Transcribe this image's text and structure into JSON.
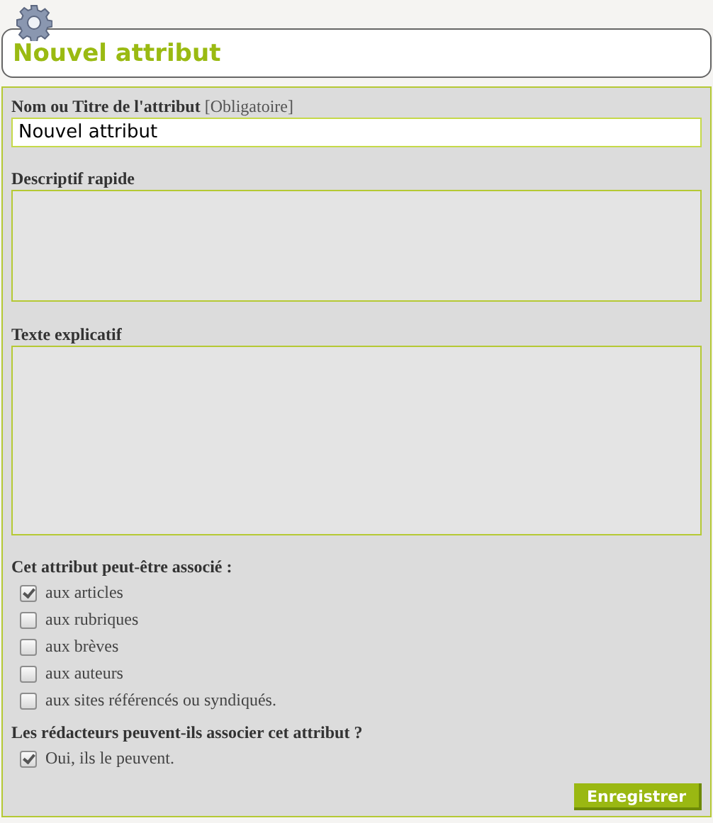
{
  "title": "Nouvel attribut",
  "name_field": {
    "label": "Nom ou Titre de l'attribut",
    "note": "[Obligatoire]",
    "value": "Nouvel attribut"
  },
  "description_field": {
    "label": "Descriptif rapide"
  },
  "explanation_field": {
    "label": "Texte explicatif"
  },
  "association": {
    "label": "Cet attribut peut-être associé :",
    "options": [
      {
        "label": "aux articles",
        "checked": true
      },
      {
        "label": "aux rubriques",
        "checked": false
      },
      {
        "label": "aux brèves",
        "checked": false
      },
      {
        "label": "aux auteurs",
        "checked": false
      },
      {
        "label": "aux sites référencés ou syndiqués.",
        "checked": false
      }
    ]
  },
  "editors": {
    "label": "Les rédacteurs peuvent-ils associer cet attribut ?",
    "options": [
      {
        "label": "Oui, ils le peuvent.",
        "checked": true
      }
    ]
  },
  "save_button": "Enregistrer"
}
